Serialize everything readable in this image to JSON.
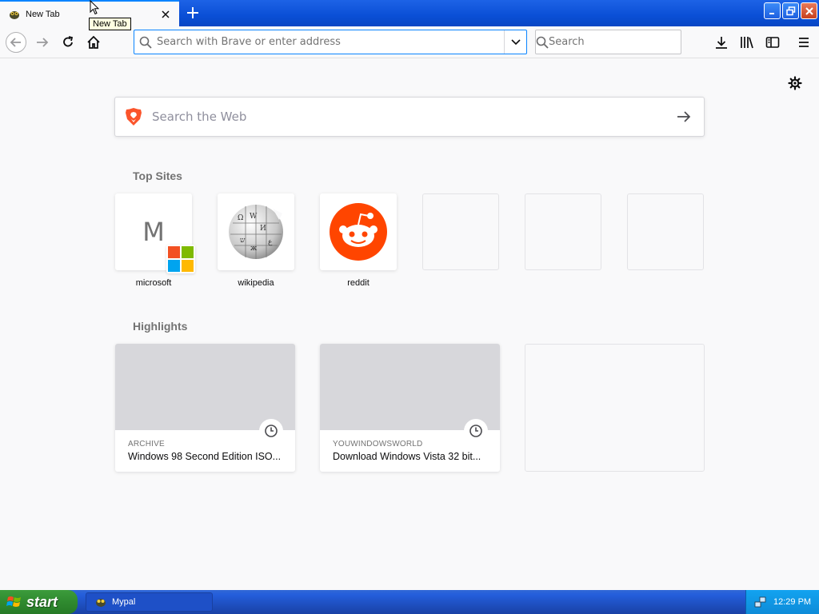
{
  "tab": {
    "title": "New Tab",
    "tooltip": "New Tab"
  },
  "navbar": {
    "url_placeholder": "Search with Brave or enter address",
    "search_placeholder": "Search"
  },
  "newtab": {
    "web_search_placeholder": "Search the Web",
    "top_sites_title": "Top Sites",
    "top_sites": [
      {
        "label": "microsoft",
        "letter": "M"
      },
      {
        "label": "wikipedia"
      },
      {
        "label": "reddit"
      }
    ],
    "highlights_title": "Highlights",
    "highlights": [
      {
        "source": "ARCHIVE",
        "title": "Windows 98 Second Edition ISO..."
      },
      {
        "source": "YOUWINDOWSWORLD",
        "title": "Download Windows Vista 32 bit..."
      }
    ]
  },
  "taskbar": {
    "start_label": "start",
    "task_label": "Mypal",
    "clock": "12:29 PM"
  },
  "colors": {
    "accent": "#0a84ff",
    "reddit": "#ff4500",
    "brave": "#fb542b"
  }
}
